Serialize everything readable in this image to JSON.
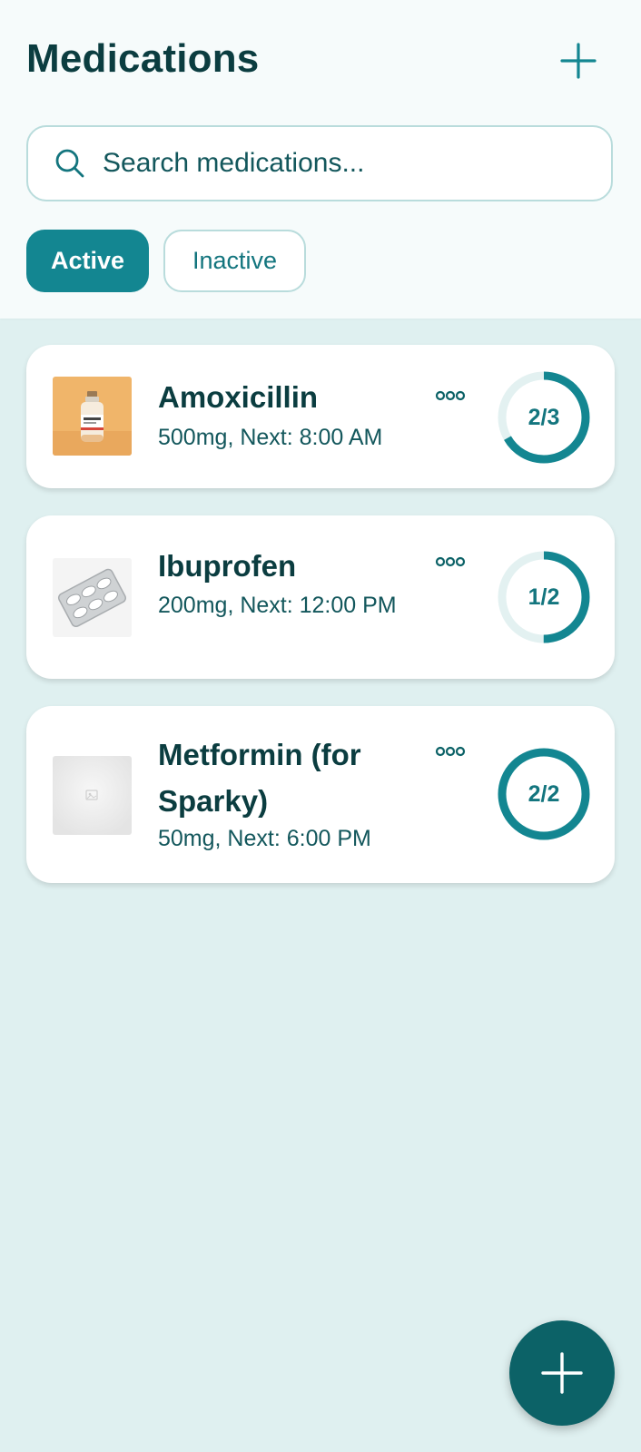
{
  "header": {
    "title": "Medications",
    "add_icon": "plus-icon"
  },
  "search": {
    "placeholder": "Search medications...",
    "icon": "search-icon"
  },
  "tabs": [
    {
      "label": "Active",
      "selected": true
    },
    {
      "label": "Inactive",
      "selected": false
    }
  ],
  "medications": [
    {
      "name": "Amoxicillin",
      "detail": "500mg, Next: 8:00 AM",
      "taken": 2,
      "total": 3,
      "progress_label": "2/3",
      "image": "medicine-bottle-photo"
    },
    {
      "name": "Ibuprofen",
      "detail": "200mg, Next: 12:00 PM",
      "taken": 1,
      "total": 2,
      "progress_label": "1/2",
      "image": "pill-blister-pack-photo"
    },
    {
      "name": "Metformin (for Sparky)",
      "detail": "50mg, Next: 6:00 PM",
      "taken": 2,
      "total": 2,
      "progress_label": "2/2",
      "image": "image-placeholder"
    }
  ],
  "fab": {
    "icon": "plus-icon"
  },
  "colors": {
    "accent": "#138691",
    "dark_teal": "#0c6267",
    "title_text": "#0b3d40",
    "ring_track": "#e3f1f1",
    "background": "#dff0f0"
  }
}
